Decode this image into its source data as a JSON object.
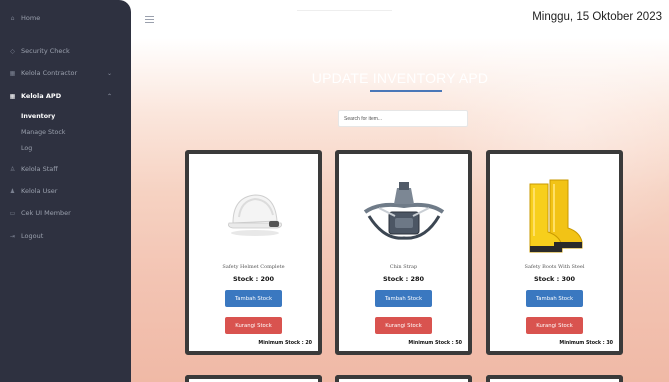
{
  "sidebar": {
    "items": [
      {
        "label": "Home",
        "icon": "home-icon"
      },
      {
        "label": "Security Check",
        "icon": "shield-icon"
      },
      {
        "label": "Kelola Contractor",
        "icon": "grid-icon"
      },
      {
        "label": "Kelola APD",
        "icon": "grid-icon"
      },
      {
        "label": "Kelola Staff",
        "icon": "user-icon"
      },
      {
        "label": "Kelola User",
        "icon": "users-icon"
      },
      {
        "label": "Cek UI Member",
        "icon": "monitor-icon"
      },
      {
        "label": "Logout",
        "icon": "logout-icon"
      }
    ],
    "apd_sub": [
      {
        "label": "Inventory"
      },
      {
        "label": "Manage Stock"
      },
      {
        "label": "Log"
      }
    ]
  },
  "header": {
    "date": "Minggu, 15 Oktober 2023"
  },
  "main": {
    "title": "UPDATE INVENTORY APD",
    "search_placeholder": "Search for item..."
  },
  "cards": [
    {
      "name": "Safety Helmet Complete",
      "stock": "Stock : 200",
      "add_label": "Tambah Stock",
      "sub_label": "Kurangi Stock",
      "min_stock": "Minimum Stock : 20"
    },
    {
      "name": "Chin Strap",
      "stock": "Stock : 280",
      "add_label": "Tambah Stock",
      "sub_label": "Kurangi Stock",
      "min_stock": "Minimum Stock : 50"
    },
    {
      "name": "Safety Boots With Steel",
      "stock": "Stock : 300",
      "add_label": "Tambah Stock",
      "sub_label": "Kurangi Stock",
      "min_stock": "Minimum Stock : 30"
    }
  ],
  "colors": {
    "sidebar_bg": "#2e3140",
    "add_button": "#3a78c0",
    "sub_button": "#d9534f",
    "title_underline": "#4a78b8"
  }
}
